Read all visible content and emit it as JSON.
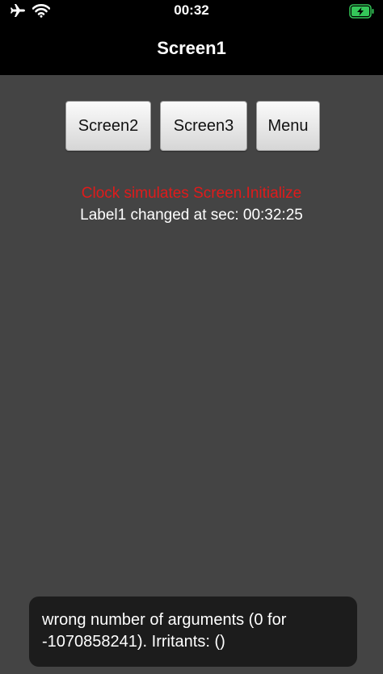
{
  "status_bar": {
    "time": "00:32",
    "icons": [
      "airplane-icon",
      "wifi-icon",
      "battery-charging-icon"
    ]
  },
  "header": {
    "title": "Screen1"
  },
  "buttons": [
    {
      "label": "Screen2"
    },
    {
      "label": "Screen3"
    },
    {
      "label": "Menu"
    }
  ],
  "labels": {
    "clock_message": "Clock simulates Screen.Initialize",
    "label1_message": "Label1 changed at sec: 00:32:25"
  },
  "toast": {
    "message": "wrong number of arguments (0 for -1070858241). Irritants: ()"
  },
  "colors": {
    "background": "#444444",
    "topbar": "#000000",
    "clock_text": "#e01b1b",
    "battery": "#34c759",
    "toast_bg": "#1c1c1c"
  }
}
